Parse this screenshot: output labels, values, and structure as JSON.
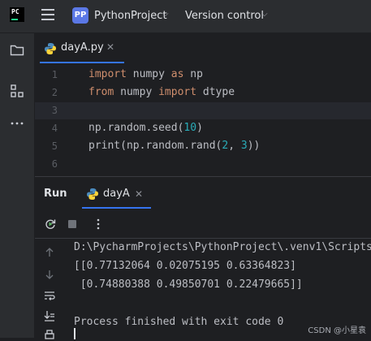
{
  "titlebar": {
    "logo_text": "PC",
    "project_badge": "PP",
    "project_name": "PythonProject",
    "vcs_label": "Version control"
  },
  "editor": {
    "tab_label": "dayA.py",
    "lines": [
      {
        "n": "1",
        "html": "<span class=\"kw\">import</span> numpy <span class=\"kw\">as</span> np"
      },
      {
        "n": "2",
        "html": "<span class=\"kw\">from</span> numpy <span class=\"kw\">import</span> dtype"
      },
      {
        "n": "3",
        "html": ""
      },
      {
        "n": "4",
        "html": "np.random.seed(<span class=\"num\">10</span>)"
      },
      {
        "n": "5",
        "html": "print(np.random.rand(<span class=\"num\">2</span>, <span class=\"num\">3</span>))"
      },
      {
        "n": "6",
        "html": ""
      }
    ]
  },
  "run": {
    "title": "Run",
    "tab_label": "dayA",
    "console": [
      "D:\\PycharmProjects\\PythonProject\\.venv1\\Scripts",
      "[[0.77132064 0.02075195 0.63364823]",
      " [0.74880388 0.49850701 0.22479665]]",
      "",
      "Process finished with exit code 0"
    ]
  },
  "watermark": "CSDN @小星袁",
  "colors": {
    "accent": "#3574f0",
    "keyword": "#cf8e6d",
    "number": "#2aacb8",
    "badge": "#5b78e6"
  }
}
